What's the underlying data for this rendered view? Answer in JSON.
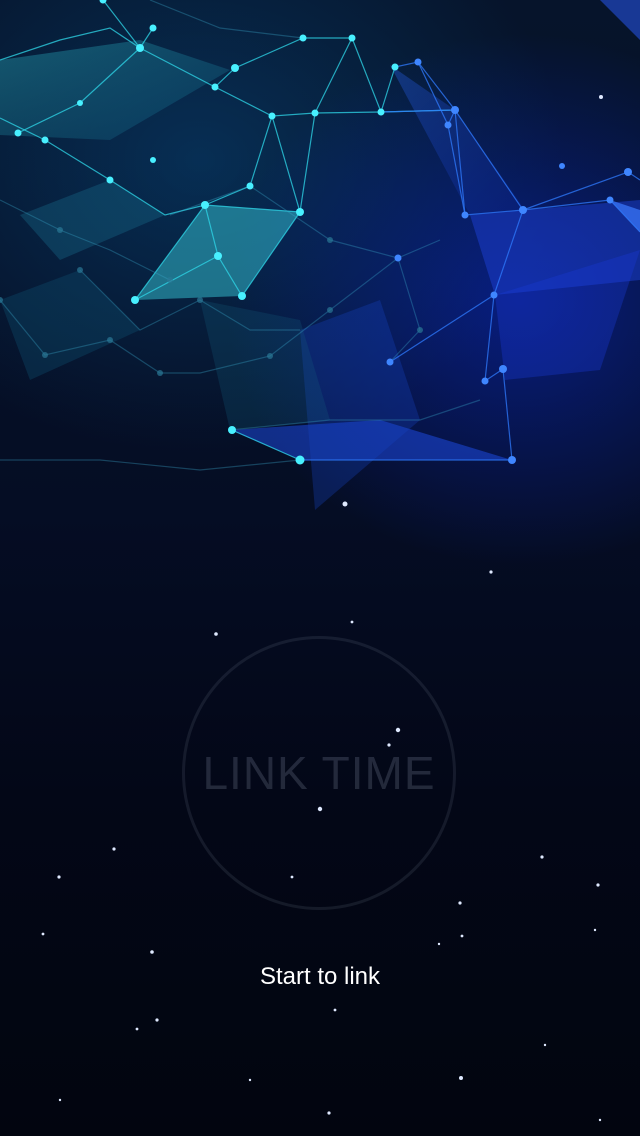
{
  "app": {
    "logo_text": "LINK TIME",
    "start_label": "Start to link"
  },
  "theme": {
    "background_top": "#06142b",
    "background_bottom": "#02050f",
    "network_cyan": "#2fe3f0",
    "network_blue": "#2a5cff",
    "circle_stroke": "#78829a",
    "label_color": "#ffffff"
  },
  "decor": {
    "background_graphic": "plexus-network-illustration",
    "stars": "scattered-star-particles"
  }
}
